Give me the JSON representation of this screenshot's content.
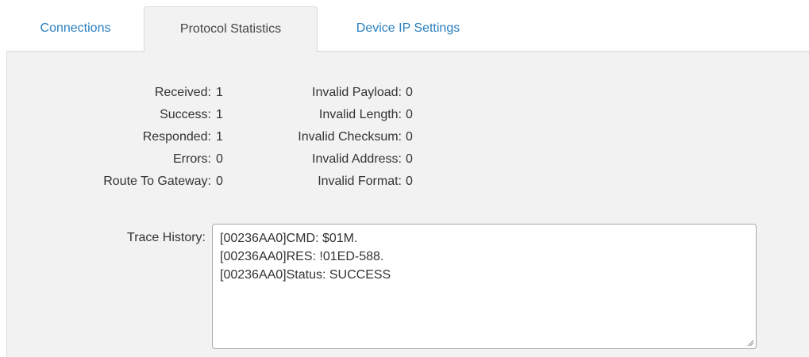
{
  "tabs": [
    {
      "label": "Connections",
      "active": false
    },
    {
      "label": "Protocol Statistics",
      "active": true
    },
    {
      "label": "Device IP Settings",
      "active": false
    }
  ],
  "stats_left": [
    {
      "label": "Received:",
      "value": "1"
    },
    {
      "label": "Success:",
      "value": "1"
    },
    {
      "label": "Responded:",
      "value": "1"
    },
    {
      "label": "Errors:",
      "value": "0"
    },
    {
      "label": "Route To Gateway:",
      "value": "0"
    }
  ],
  "stats_right": [
    {
      "label": "Invalid Payload:",
      "value": "0"
    },
    {
      "label": "Invalid Length:",
      "value": "0"
    },
    {
      "label": "Invalid Checksum:",
      "value": "0"
    },
    {
      "label": "Invalid Address:",
      "value": "0"
    },
    {
      "label": "Invalid Format:",
      "value": "0"
    }
  ],
  "trace": {
    "label": "Trace History:",
    "lines": [
      "[00236AA0]CMD: $01M.",
      "[00236AA0]RES: !01ED-588.",
      "[00236AA0]Status: SUCCESS"
    ]
  },
  "colors": {
    "link": "#2a7fbf",
    "panel_bg": "#f2f2f2",
    "border": "#d9d9d9",
    "text": "#333333"
  }
}
